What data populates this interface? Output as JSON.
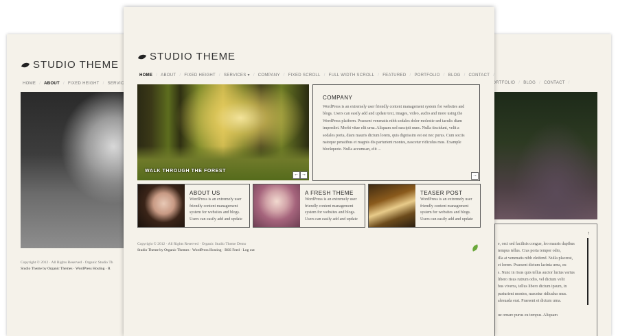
{
  "theme": {
    "background": "#f5f2ea",
    "text": "#333333",
    "border": "#555555"
  },
  "left_preview": {
    "logo": "STUDIO THEME",
    "nav": [
      "HOME",
      "ABOUT",
      "FIXED HEIGHT",
      "SERVICES ▾"
    ],
    "footer_line1": "Copyright © 2012 · All Rights Reserved · Organic Studio Th",
    "footer_line2": "Studio Theme by Organic Themes · WordPress Hosting · R"
  },
  "center_page": {
    "logo": "STUDIO THEME",
    "nav": [
      "HOME",
      "ABOUT",
      "FIXED HEIGHT",
      "SERVICES ▾",
      "COMPANY",
      "FIXED SCROLL",
      "FULL WIDTH SCROLL",
      "FEATURED",
      "PORTFOLIO",
      "BLOG",
      "CONTACT"
    ],
    "slider_caption": "WALK THROUGH THE FOREST",
    "company": {
      "title": "COMPANY",
      "body": "WordPress is an extremely user friendly content management system for websites and blogs. Users can easily add and update text, images, video, audio and more using the WordPress platform. Praesent venenatis nibh sodales dolor molestie sed iaculis diam imperdiet. Morbi vitae elit urna. Aliquam sed suscipit nunc. Nulla tincidunt, velit a sodales porta, diam mauris dictum lorem, quis dignissim est est nec purus. Cum sociis natoque penatibus et magnis dis parturient montes, nascetur ridiculus mus. Example blockquote. Nulla accumsan, elit ..."
    },
    "cards": [
      {
        "title": "ABOUT US",
        "body": "WordPress is an extremely user friendly content management system for websites and blogs. Users can easily add and update"
      },
      {
        "title": "A FRESH THEME",
        "body": "WordPress is an extremely user friendly content management system for websites and blogs. Users can easily add and update"
      },
      {
        "title": "TEASER POST",
        "body": "WordPress is an extremely user friendly content management system for websites and blogs. Users can easily add and update"
      }
    ],
    "footer_line1": "Copyright © 2012 · All Rights Reserved · Organic Studio Theme Demo",
    "footer_line2": {
      "a": "Studio Theme",
      "b": " by ",
      "c": "Organic Themes",
      "d": " · ",
      "e": "WordPress Hosting",
      "f": " · ",
      "g": "RSS Feed",
      "h": " · ",
      "i": "Log out"
    }
  },
  "right_preview": {
    "nav": [
      "PORTFOLIO",
      "BLOG",
      "CONTACT"
    ],
    "text_lines": [
      "e, orci sed facilisis congue, leo mauris dapibus",
      "tempus tellus. Cras porta tempor odio,",
      "illa at venenatis nibh eleifend. Nulla placerat,",
      "et lorem. Praesent dictum lacinia urna, eu",
      "s. Nunc in risus quis tellus auctor luctus varius",
      "libero risus rutrum odio, vel dictum velit",
      "bus viverra, tellus libero dictum ipsum, in",
      "parturient montes, nascetur ridiculus mus.",
      "alesuada erat. Praesent et dictum urna.",
      "",
      "ue ornare purus eu tempus. Aliquam"
    ]
  }
}
